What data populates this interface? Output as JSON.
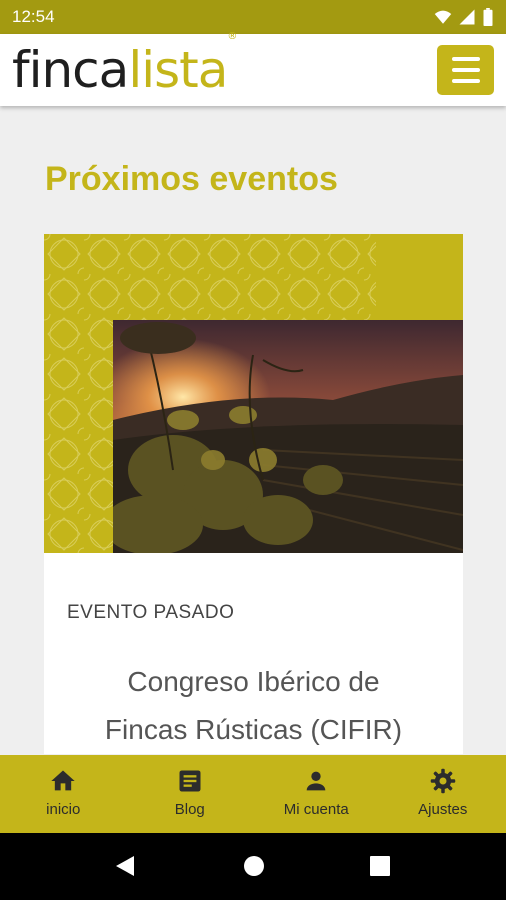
{
  "status_bar": {
    "time": "12:54",
    "icons": [
      "wifi-icon",
      "signal-icon",
      "battery-icon"
    ]
  },
  "header": {
    "logo_dark": "finca",
    "logo_accent": "lista",
    "logo_mark": "®",
    "menu_icon": "hamburger-menu-icon"
  },
  "main": {
    "title": "Próximos eventos",
    "event": {
      "status": "EVENTO PASADO",
      "title_line1": "Congreso Ibérico de",
      "title_line2": "Fincas Rústicas (CIFIR)",
      "image": "vineyard-sunset-photo"
    }
  },
  "bottom_nav": [
    {
      "label": "inicio",
      "icon": "home-icon"
    },
    {
      "label": "Blog",
      "icon": "blog-icon"
    },
    {
      "label": "Mi cuenta",
      "icon": "account-icon"
    },
    {
      "label": "Ajustes",
      "icon": "settings-icon"
    }
  ],
  "system_nav": {
    "icons": [
      "back-icon",
      "home-circle-icon",
      "recents-icon"
    ]
  },
  "colors": {
    "accent": "#c4b51a",
    "status_bar": "#a39a11",
    "text_dark": "#2c2c2c"
  }
}
